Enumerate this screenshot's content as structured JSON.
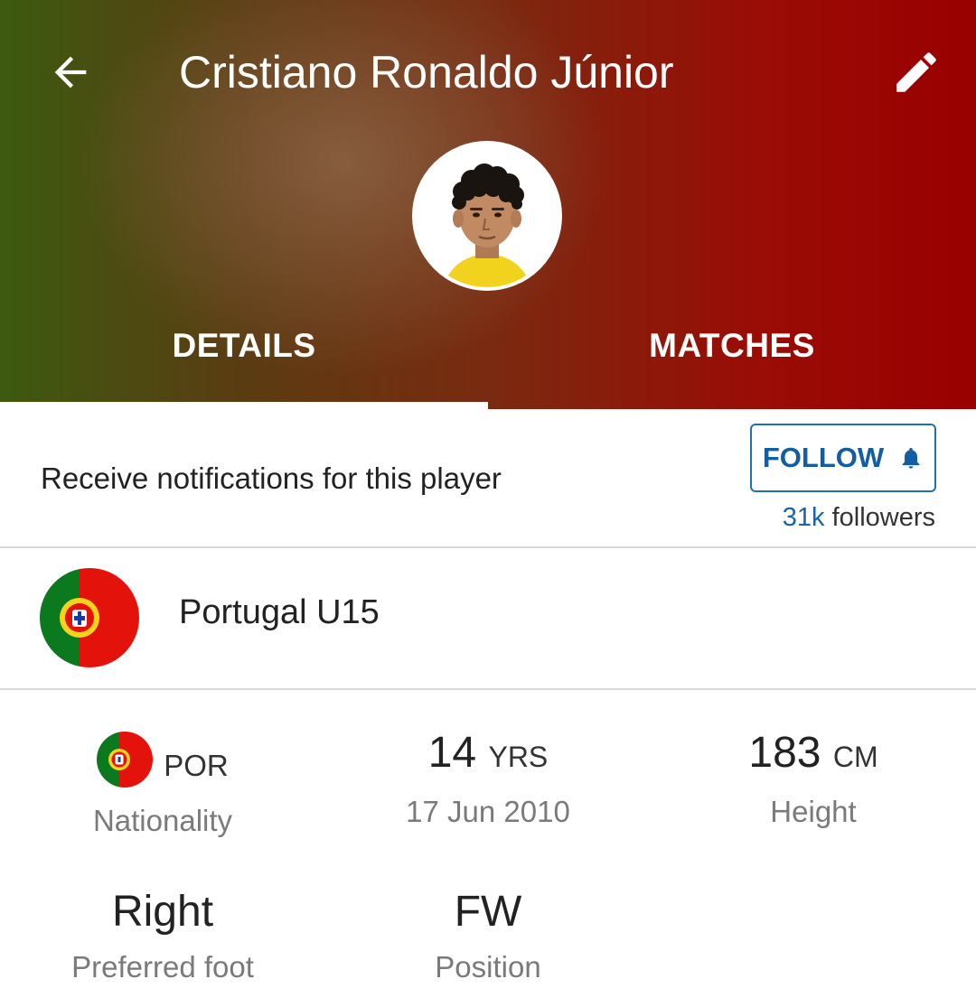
{
  "header": {
    "title": "Cristiano Ronaldo Júnior",
    "back_icon": "arrow-left-icon",
    "edit_icon": "pencil-icon",
    "gradient_colors": [
      "#3d5a10",
      "#7a2a10",
      "#990000"
    ],
    "tabs": [
      {
        "label": "DETAILS",
        "active": true
      },
      {
        "label": "MATCHES",
        "active": false
      }
    ]
  },
  "follow": {
    "description": "Receive notifications for this player",
    "button_label": "FOLLOW",
    "button_icon": "bell-icon",
    "followers_count": "31k",
    "followers_label": "followers",
    "accent_color": "#145da0"
  },
  "team": {
    "name": "Portugal U15",
    "flag_icon": "portugal-flag-icon"
  },
  "stats": {
    "nationality": {
      "value": "POR",
      "label": "Nationality",
      "flag_icon": "portugal-flag-icon"
    },
    "age": {
      "value": "14",
      "unit": "YRS",
      "label": "17 Jun 2010"
    },
    "height": {
      "value": "183",
      "unit": "CM",
      "label": "Height"
    },
    "foot": {
      "value": "Right",
      "label": "Preferred foot"
    },
    "position": {
      "value": "FW",
      "label": "Position"
    }
  }
}
